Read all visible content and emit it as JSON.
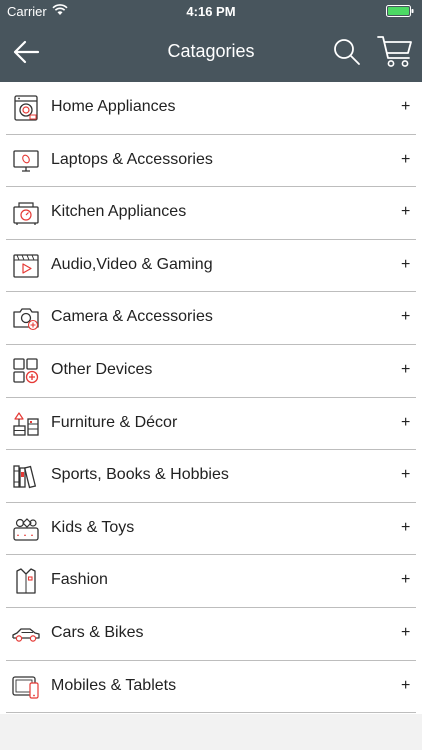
{
  "status_bar": {
    "carrier": "Carrier",
    "time": "4:16 PM",
    "wifi_icon": "wifi-icon",
    "battery_icon": "battery-icon"
  },
  "nav": {
    "title": "Catagories",
    "back_icon": "arrow-left-icon",
    "search_icon": "search-icon",
    "cart_icon": "cart-icon"
  },
  "colors": {
    "nav_bg": "#48555d",
    "accent": "#e53935",
    "battery": "#4cd964",
    "divider": "#bdbdbd",
    "page_bg": "#f2f2f2"
  },
  "expand_symbol": "+",
  "categories": [
    {
      "label": "Home Appliances",
      "icon": "washing-machine-icon"
    },
    {
      "label": "Laptops & Accessories",
      "icon": "monitor-icon"
    },
    {
      "label": "Kitchen Appliances",
      "icon": "microwave-icon"
    },
    {
      "label": "Audio,Video & Gaming",
      "icon": "video-player-icon"
    },
    {
      "label": "Camera & Accessories",
      "icon": "camera-icon"
    },
    {
      "label": "Other Devices",
      "icon": "devices-grid-icon"
    },
    {
      "label": "Furniture & Décor",
      "icon": "lamp-furniture-icon"
    },
    {
      "label": "Sports, Books & Hobbies",
      "icon": "books-icon"
    },
    {
      "label": "Kids & Toys",
      "icon": "toys-basket-icon"
    },
    {
      "label": "Fashion",
      "icon": "shirt-icon"
    },
    {
      "label": "Cars & Bikes",
      "icon": "car-icon"
    },
    {
      "label": "Mobiles & Tablets",
      "icon": "tablet-phone-icon"
    }
  ]
}
